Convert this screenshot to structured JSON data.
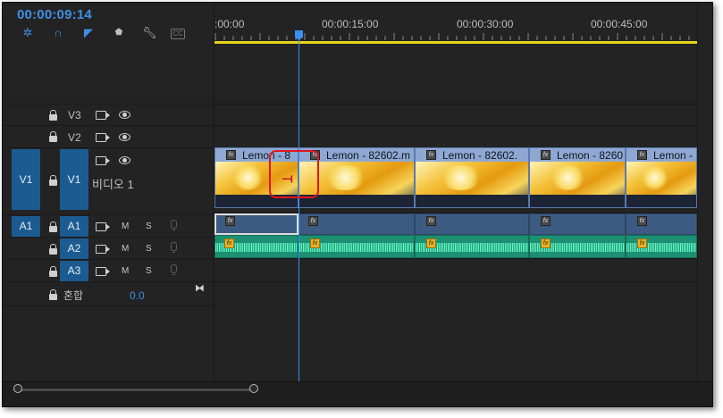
{
  "timecode": "00:00:09:14",
  "toolbar": {
    "icons": [
      "snap-icon",
      "linked-selection-icon",
      "add-marker-icon",
      "marker-icon",
      "wrench-icon",
      "captions-icon"
    ]
  },
  "ruler": {
    "labels": [
      ":00:00",
      "00:00:15:00",
      "00:00:30:00",
      "00:00:45:00"
    ]
  },
  "tracks": {
    "v3": {
      "label": "V3"
    },
    "v2": {
      "label": "V2"
    },
    "v1": {
      "source": "V1",
      "label": "V1",
      "name": "비디오 1"
    },
    "a1": {
      "source": "A1",
      "label": "A1",
      "m": "M",
      "s": "S"
    },
    "a2": {
      "label": "A2",
      "m": "M",
      "s": "S"
    },
    "a3": {
      "label": "A3",
      "m": "M",
      "s": "S"
    },
    "mix": {
      "label": "혼합",
      "value": "0.0"
    }
  },
  "clips": [
    {
      "name": "Lemon - 8"
    },
    {
      "name": "Lemon - 82602.m"
    },
    {
      "name": "Lemon - 82602."
    },
    {
      "name": "Lemon - 8260"
    },
    {
      "name": "Lemon -"
    }
  ],
  "fx_label": "fx",
  "colors": {
    "accent": "#3f8fe8",
    "highlight": "#e0161d",
    "workarea": "#e7d41a",
    "audio": "#1d8f73",
    "video": "#8ea8d3"
  }
}
